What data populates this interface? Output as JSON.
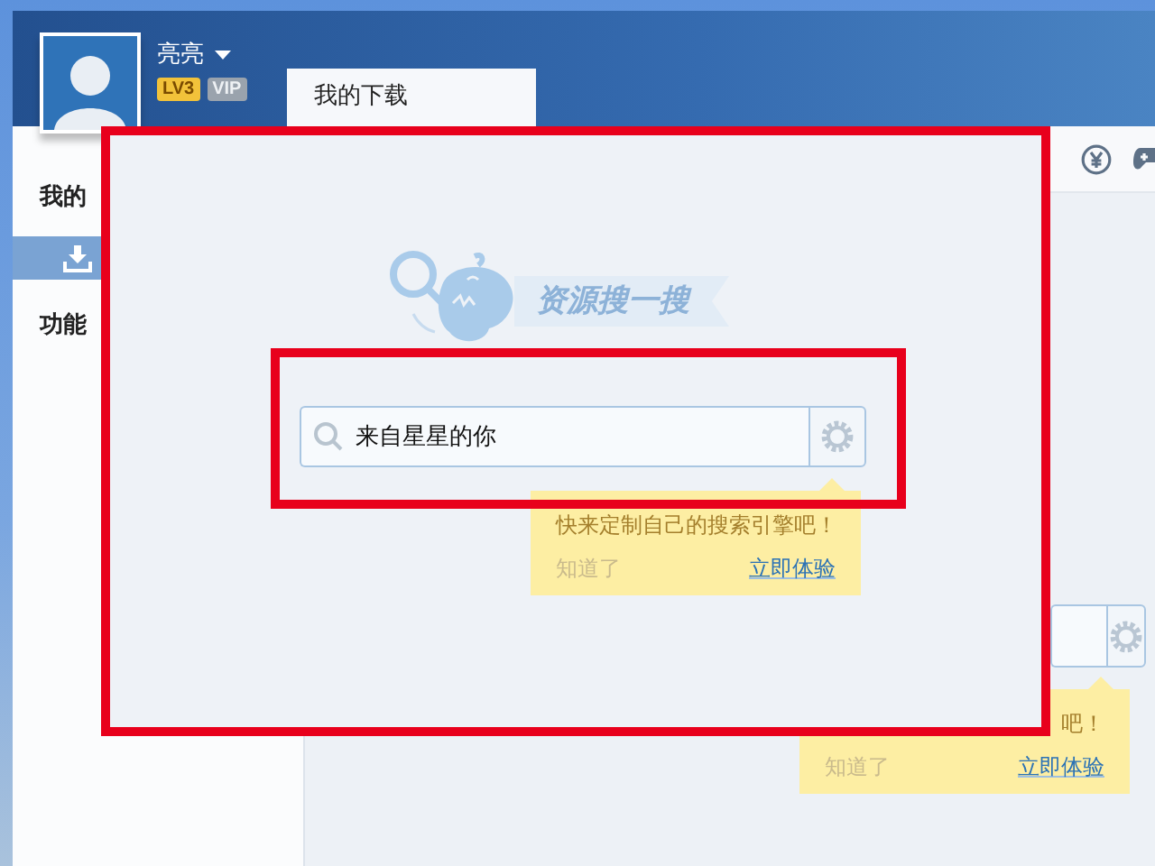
{
  "header": {
    "user_name": "亮亮",
    "badges": [
      {
        "label": "LV3",
        "kind": "level"
      },
      {
        "label": "VIP",
        "kind": "vip"
      }
    ],
    "tabs": [
      {
        "label": "我的下载",
        "selected": true
      }
    ]
  },
  "sidebar": {
    "sections": [
      {
        "title": "我的",
        "items": [
          {
            "selected": true
          }
        ]
      },
      {
        "title": "功能"
      }
    ]
  },
  "background_tooltip": {
    "message": "吧！",
    "dismiss": "知道了",
    "action": "立即体验"
  },
  "inset": {
    "logo_banner": "资源搜一搜",
    "search": {
      "value": "来自星星的你"
    },
    "tooltip": {
      "message": "快来定制自己的搜索引擎吧！",
      "dismiss": "知道了",
      "action": "立即体验"
    }
  }
}
